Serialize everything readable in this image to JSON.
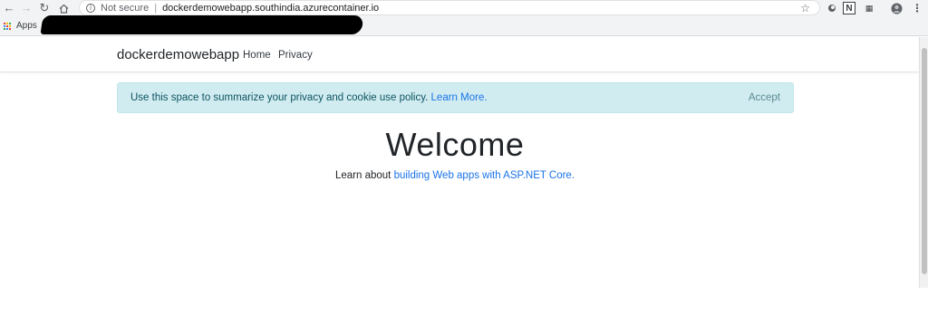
{
  "browser": {
    "security_label": "Not secure",
    "url": "dockerdemowebapp.southindia.azurecontainer.io",
    "bookmarks_apps_label": "Apps"
  },
  "site": {
    "brand": "dockerdemowebapp",
    "nav": [
      "Home",
      "Privacy"
    ]
  },
  "cookie_banner": {
    "text": "Use this space to summarize your privacy and cookie use policy.",
    "link": "Learn More.",
    "accept": "Accept"
  },
  "main": {
    "heading": "Welcome",
    "learn_prefix": "Learn about",
    "learn_link": "building Web apps with ASP.NET Core."
  },
  "colors": {
    "alert_bg": "#d1ecf1",
    "link": "#1a73e8",
    "text": "#212529"
  }
}
